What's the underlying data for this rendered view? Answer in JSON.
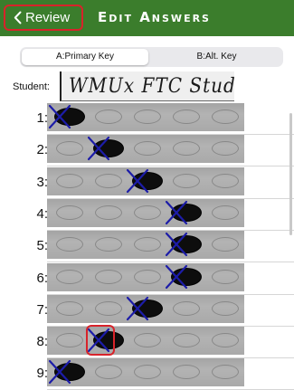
{
  "nav": {
    "back_label": "Review",
    "title": "Edit Answers"
  },
  "key_tabs": {
    "primary": "A:Primary Key",
    "alt": "B:Alt. Key",
    "selected": "A:Primary Key"
  },
  "student": {
    "label": "Student:",
    "handwritten_name": "WMUx FTC Student"
  },
  "choices_per_question": 5,
  "questions": [
    {
      "label": "1:",
      "filled_bubble": 1,
      "marked_bubble": 1
    },
    {
      "label": "2:",
      "filled_bubble": 2,
      "marked_bubble": 2
    },
    {
      "label": "3:",
      "filled_bubble": 3,
      "marked_bubble": 3
    },
    {
      "label": "4:",
      "filled_bubble": 4,
      "marked_bubble": 4
    },
    {
      "label": "5:",
      "filled_bubble": 4,
      "marked_bubble": 4
    },
    {
      "label": "6:",
      "filled_bubble": 4,
      "marked_bubble": 4
    },
    {
      "label": "7:",
      "filled_bubble": 3,
      "marked_bubble": 3
    },
    {
      "label": "8:",
      "filled_bubble": 2,
      "marked_bubble": 2,
      "highlighted": true
    },
    {
      "label": "9:",
      "filled_bubble": 1,
      "marked_bubble": 1
    }
  ],
  "colors": {
    "nav_bar": "#3b7d2c",
    "highlight": "#d8232a",
    "answer_mark": "#1c1ca8",
    "pencil_fill": "#0d0d0d"
  },
  "icons": {
    "back": "chevron-left-icon",
    "answer_mark": "x-mark-icon"
  }
}
